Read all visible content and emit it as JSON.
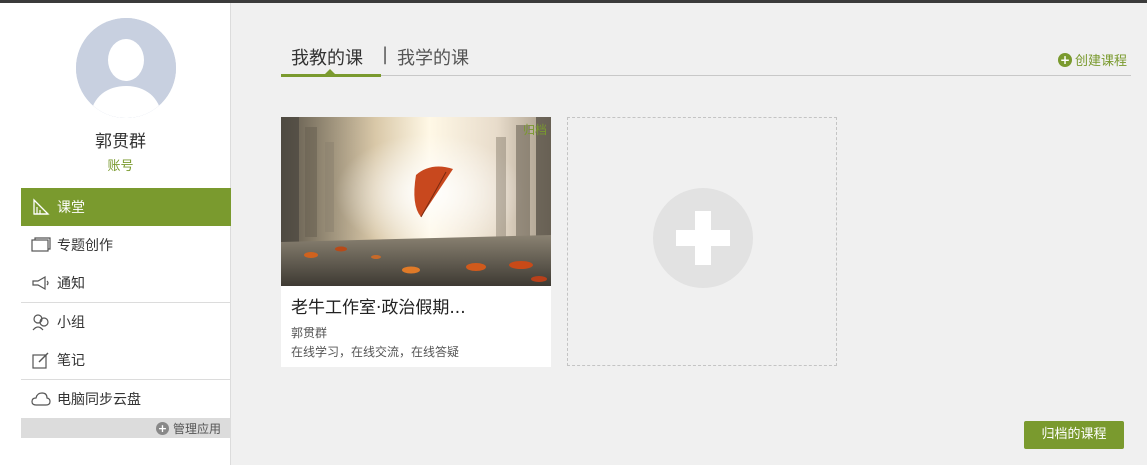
{
  "user": {
    "name": "郭贯群",
    "account_label": "账号"
  },
  "sidebar": {
    "items": [
      {
        "label": "课堂",
        "icon": "classroom-icon",
        "active": true
      },
      {
        "label": "专题创作",
        "icon": "topic-icon"
      },
      {
        "label": "通知",
        "icon": "notify-icon"
      },
      {
        "label": "小组",
        "icon": "group-icon"
      },
      {
        "label": "笔记",
        "icon": "note-icon"
      },
      {
        "label": "电脑同步云盘",
        "icon": "cloud-icon"
      }
    ],
    "manage_apps": "管理应用"
  },
  "tabs": {
    "teach": "我教的课",
    "separator": "|",
    "learn": "我学的课"
  },
  "create_course": "创建课程",
  "course": {
    "archive": "归档",
    "title": "老牛工作室·政治假期...",
    "teacher": "郭贯群",
    "description": "在线学习，在线交流，在线答疑"
  },
  "archived_courses_button": "归档的课程",
  "colors": {
    "accent": "#7a9a2e",
    "topbar": "#3b3b3b",
    "background": "#f0f0f0"
  }
}
